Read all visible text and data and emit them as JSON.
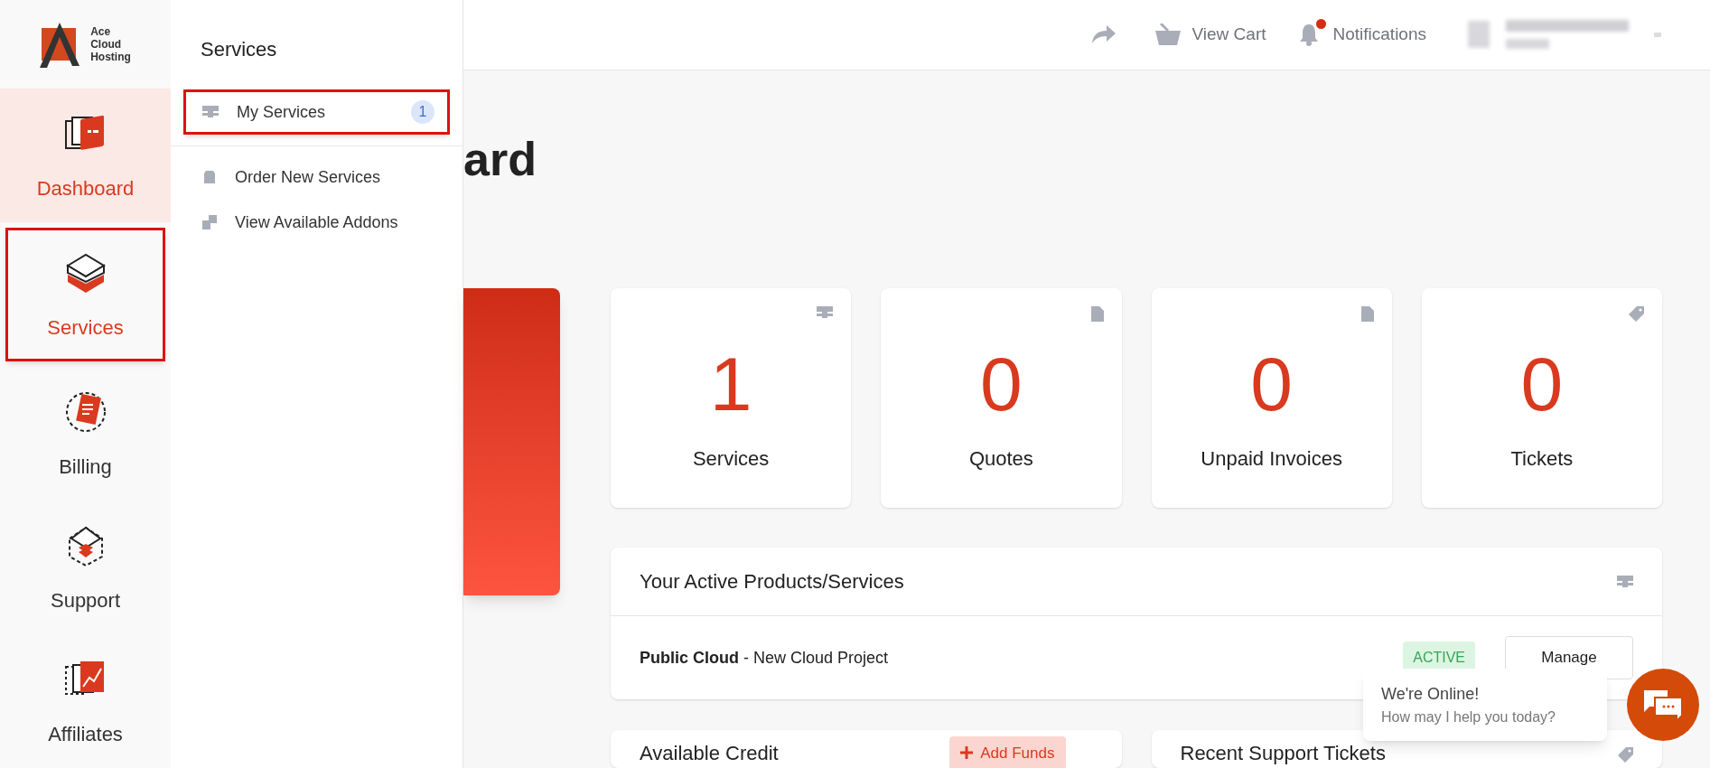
{
  "logo": {
    "lines": [
      "Ace",
      "Cloud",
      "Hosting"
    ]
  },
  "nav": [
    {
      "label": "Dashboard",
      "kind": "dashboard",
      "selected": true,
      "open": true,
      "outlined": false
    },
    {
      "label": "Services",
      "kind": "services",
      "selected": false,
      "open": true,
      "outlined": true
    },
    {
      "label": "Billing",
      "kind": "billing",
      "selected": false,
      "open": false,
      "outlined": false
    },
    {
      "label": "Support",
      "kind": "support",
      "selected": false,
      "open": false,
      "outlined": false
    },
    {
      "label": "Affiliates",
      "kind": "affiliates",
      "selected": false,
      "open": false,
      "outlined": false
    }
  ],
  "flyout": {
    "title": "Services",
    "items": [
      {
        "label": "My Services",
        "kind": "server",
        "count": "1",
        "outlined": true
      },
      {
        "label": "Order New Services",
        "kind": "box",
        "outlined": false
      },
      {
        "label": "View Available Addons",
        "kind": "addons",
        "outlined": false
      }
    ]
  },
  "header": {
    "actions": [
      {
        "kind": "share"
      },
      {
        "kind": "cart",
        "label": "View Cart"
      },
      {
        "kind": "bell",
        "label": "Notifications",
        "badge": true
      }
    ]
  },
  "page_title": "ard",
  "stats": [
    {
      "value": "1",
      "label": "Services",
      "kind": "server"
    },
    {
      "value": "0",
      "label": "Quotes",
      "kind": "document"
    },
    {
      "value": "0",
      "label": "Unpaid Invoices",
      "kind": "document"
    },
    {
      "value": "0",
      "label": "Tickets",
      "kind": "tag"
    }
  ],
  "active_products": {
    "title": "Your Active Products/Services",
    "items": [
      {
        "name": "**Public Cloud** - New Cloud Project",
        "status": "ACTIVE",
        "action": "Manage"
      }
    ]
  },
  "credit": {
    "title": "Available Credit",
    "button": "Add Funds"
  },
  "tickets": {
    "title": "Recent Support Tickets"
  },
  "chat": {
    "title": "We're Online!",
    "subtitle": "How may I help you today?"
  }
}
